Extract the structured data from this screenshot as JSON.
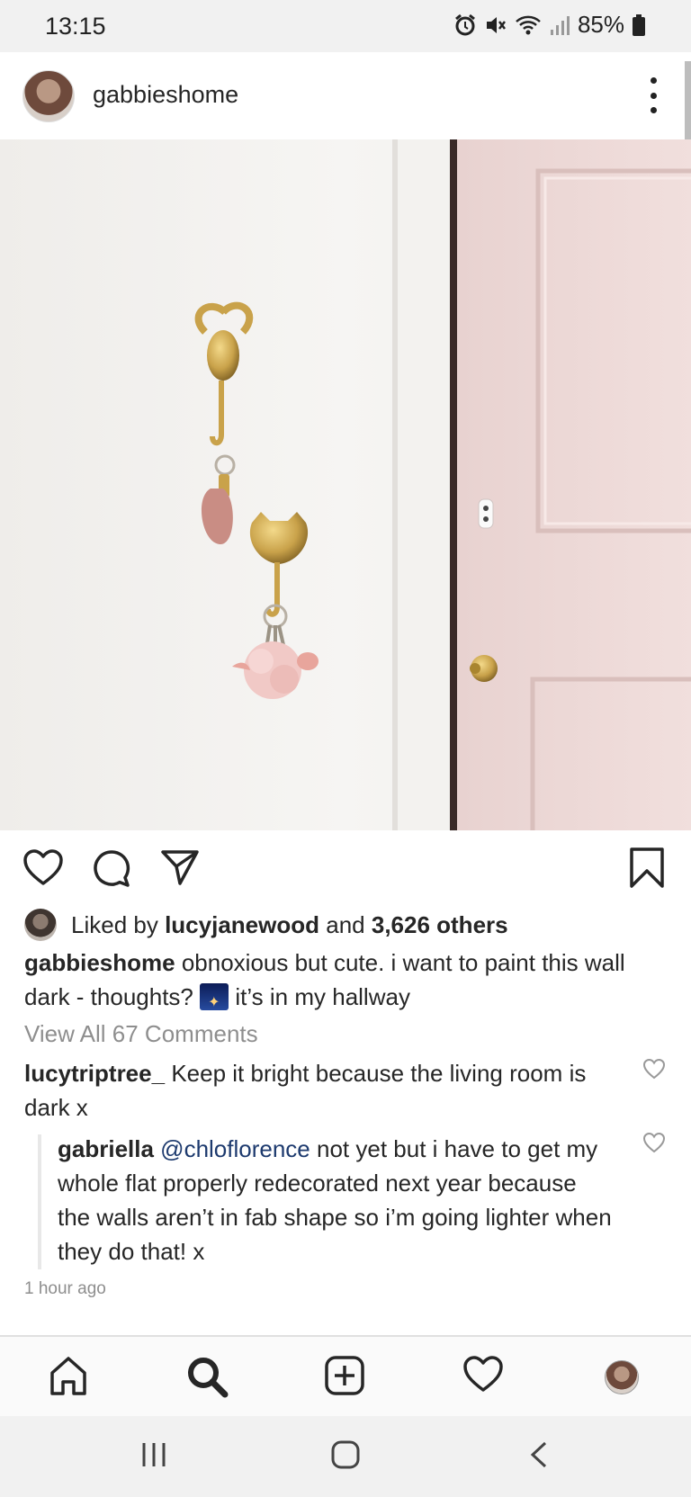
{
  "status_bar": {
    "time": "13:15",
    "battery": "85%",
    "icons": [
      "alarm-icon",
      "mute-icon",
      "wifi-icon",
      "signal-icon",
      "battery-icon"
    ]
  },
  "post": {
    "username": "gabbieshome",
    "liked_by_user": "lucyjanewood",
    "liked_by_prefix": "Liked by",
    "liked_by_and": "and",
    "likes_others": "3,626 others",
    "caption_user": "gabbieshome",
    "caption_text_1": "obnoxious but cute. i want to paint this wall dark - thoughts?",
    "caption_text_2": "it’s in my hallway",
    "caption_emoji": "night-sky-emoji",
    "view_all_comments": "View All 67 Comments",
    "comments": [
      {
        "user": "lucytriptree_",
        "text": "Keep it bright because the living room is dark x"
      },
      {
        "user": "gabriella",
        "mention": "@chloflorence",
        "text": "not yet but i have to get my whole flat properly redecorated next year because the walls aren’t in fab shape so i’m going lighter when they do that! x"
      }
    ],
    "timestamp": "1 hour ago"
  },
  "actions": [
    "heart-icon",
    "comment-icon",
    "share-icon",
    "bookmark-icon"
  ],
  "bottom_nav": [
    "home-icon",
    "search-icon",
    "add-post-icon",
    "activity-heart-icon",
    "profile-avatar"
  ],
  "colors": {
    "text": "#262626",
    "muted": "#8e8e8e",
    "mention": "#1d3a6e",
    "door_pink": "#eed8d6",
    "wall": "#f4f1ee",
    "brass": "#c9a24a"
  }
}
